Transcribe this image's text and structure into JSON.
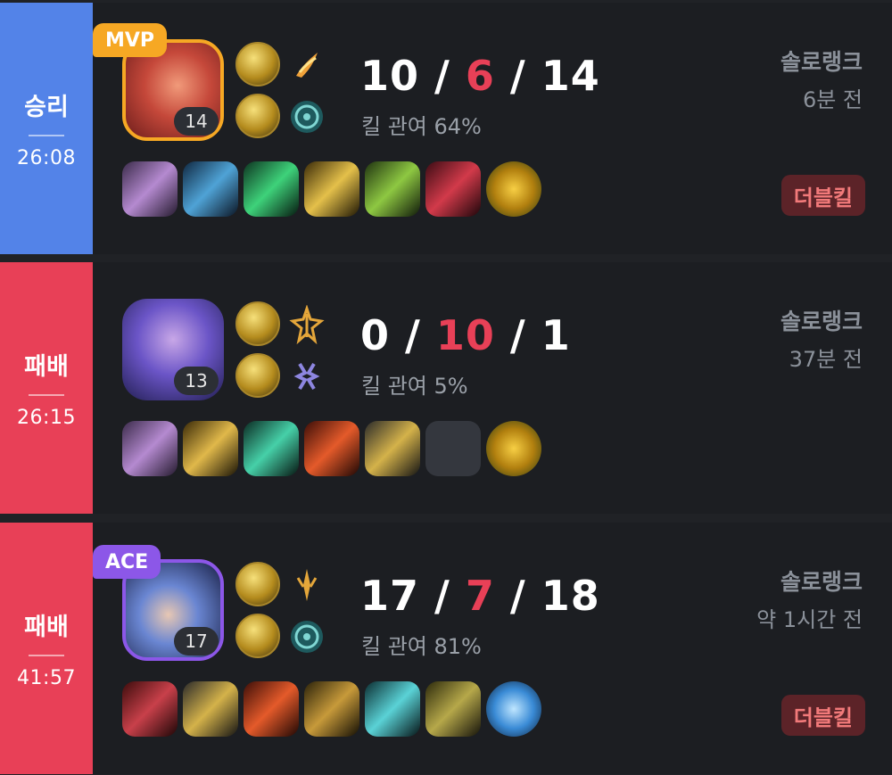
{
  "matches": [
    {
      "result": "승리",
      "duration": "26:08",
      "badge": "MVP",
      "champion_level": "14",
      "kills": "10",
      "deaths": "6",
      "assists": "14",
      "kill_participation": "킬 관여 64%",
      "queue": "솔로랭크",
      "time_ago": "6분 전",
      "multikill": "더블킬",
      "items": [
        "item-1",
        "item-2",
        "item-3",
        "item-4",
        "item-5",
        "item-6",
        "trinket"
      ]
    },
    {
      "result": "패배",
      "duration": "26:15",
      "champion_level": "13",
      "kills": "0",
      "deaths": "10",
      "assists": "1",
      "kill_participation": "킬 관여 5%",
      "queue": "솔로랭크",
      "time_ago": "37분 전",
      "items": [
        "item-1",
        "item-2",
        "item-3",
        "item-4",
        "item-5",
        "empty",
        "trinket"
      ]
    },
    {
      "result": "패배",
      "duration": "41:57",
      "badge": "ACE",
      "champion_level": "17",
      "kills": "17",
      "deaths": "7",
      "assists": "18",
      "kill_participation": "킬 관여 81%",
      "queue": "솔로랭크",
      "time_ago": "약 1시간 전",
      "multikill": "더블킬",
      "items": [
        "item-1",
        "item-2",
        "item-3",
        "item-4",
        "item-5",
        "item-6",
        "trinket"
      ]
    }
  ],
  "colors": {
    "win": "#5383e8",
    "loss": "#e84057",
    "mvp": "#f6a824",
    "ace": "#8c57e8",
    "deaths": "#e84057"
  }
}
